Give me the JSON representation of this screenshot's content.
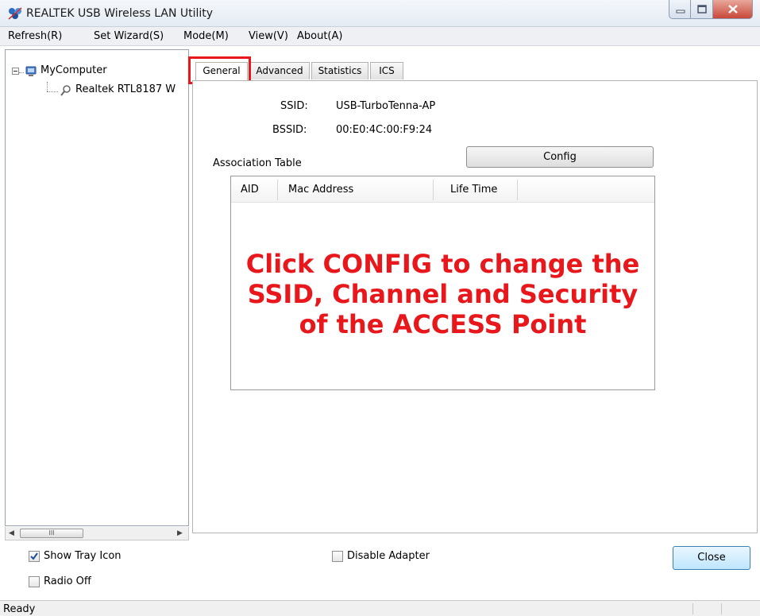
{
  "window": {
    "title": "REALTEK USB Wireless LAN Utility",
    "icon": "realtek-app-icon",
    "controls": [
      "minimize",
      "maximize",
      "close"
    ]
  },
  "menu": {
    "items": [
      "Refresh(R)",
      "Set Wizard(S)",
      "Mode(M)",
      "View(V)",
      "About(A)"
    ]
  },
  "tree": {
    "root": "MyComputer",
    "child": "Realtek RTL8187 W",
    "root_icon": "computer-icon",
    "child_icon": "wireless-adapter-icon",
    "scroll_thumb": "III"
  },
  "tabs": {
    "items": [
      "General",
      "Advanced",
      "Statistics",
      "ICS"
    ],
    "active": "General",
    "highlight_color": "#e8171b"
  },
  "general": {
    "ssid_label": "SSID:",
    "ssid_value": "USB-TurboTenna-AP",
    "bssid_label": "BSSID:",
    "bssid_value": "00:E0:4C:00:F9:24",
    "assoc_table_label": "Association Table",
    "config_button": "Config",
    "columns": [
      "AID",
      "Mac Address",
      "Life Time"
    ],
    "rows": []
  },
  "annotation": {
    "lines": [
      "Click CONFIG to change the",
      "SSID, Channel and Security",
      "of the ACCESS Point"
    ],
    "color": "#e8171b"
  },
  "options": {
    "show_tray_icon": {
      "label": "Show Tray Icon",
      "checked": true
    },
    "radio_off": {
      "label": "Radio Off",
      "checked": false
    },
    "disable_adapter": {
      "label": "Disable Adapter",
      "checked": false
    },
    "close_button": "Close"
  },
  "status": {
    "text": "Ready"
  }
}
